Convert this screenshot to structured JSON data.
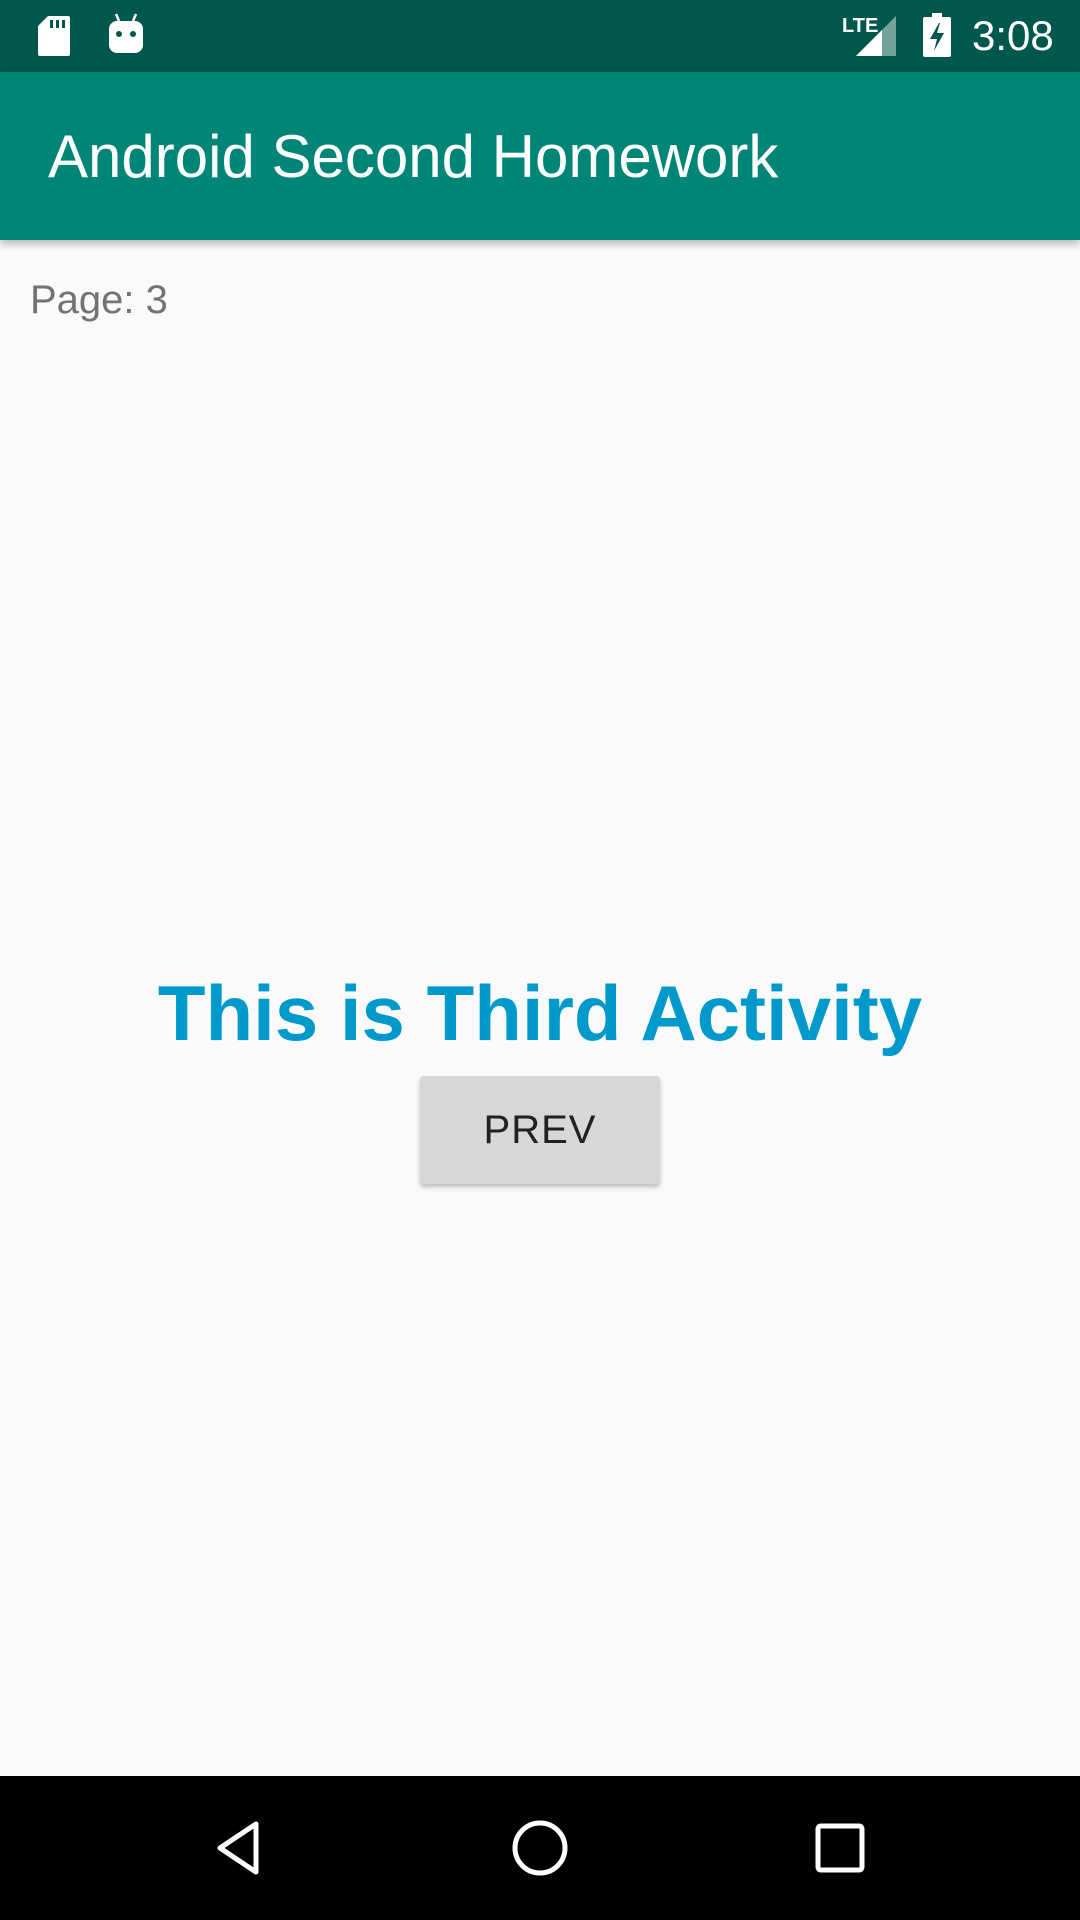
{
  "status_bar": {
    "network_type": "LTE",
    "time": "3:08",
    "icons": [
      "sd-card-icon",
      "android-debug-icon",
      "lte-signal-icon",
      "battery-charging-icon"
    ]
  },
  "app_bar": {
    "title": "Android Second Homework",
    "color": "#008577"
  },
  "content": {
    "page_label": "Page: 3",
    "headline": "This is Third Activity",
    "headline_color": "#0099cc",
    "prev_button_label": "PREV"
  },
  "nav_bar": {
    "icons": [
      "back-icon",
      "home-icon",
      "recents-icon"
    ]
  }
}
